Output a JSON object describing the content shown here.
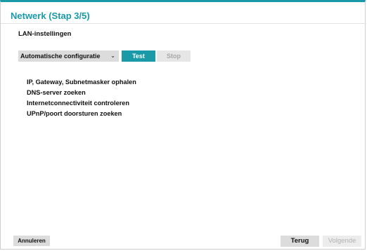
{
  "window": {
    "title": "Netwerk (Stap 3/5)"
  },
  "lan": {
    "section_label": "LAN-instellingen",
    "config_select": {
      "selected": "Automatische configuratie",
      "icon": "chevron-down-icon"
    },
    "test_label": "Test",
    "stop_label": "Stop",
    "steps": [
      "IP, Gateway, Subnetmasker ophalen",
      "DNS-server zoeken",
      "Internetconnectiviteit controleren",
      "UPnP/poort doorsturen zoeken"
    ]
  },
  "footer": {
    "cancel_label": "Annuleren",
    "back_label": "Terug",
    "next_label": "Volgende"
  },
  "colors": {
    "accent": "#1a9aa8",
    "button_gray": "#dcdcdc",
    "disabled_text": "#a8a8a8"
  }
}
